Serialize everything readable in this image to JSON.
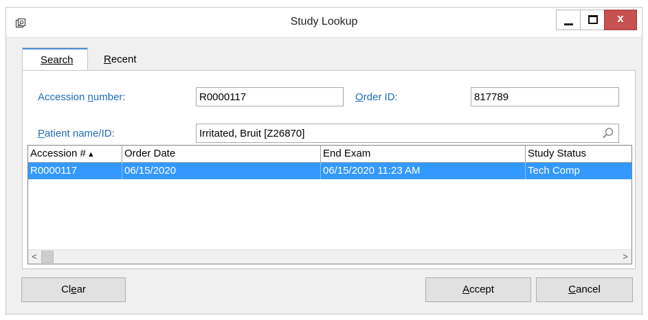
{
  "window": {
    "title": "Study Lookup",
    "close_glyph": "x"
  },
  "tabs": {
    "search": "Search",
    "recent": "Recent"
  },
  "fields": {
    "accession_label": "Accession number:",
    "accession_value": "R0000117",
    "order_id_label": "Order ID:",
    "order_id_value": "817789",
    "patient_label": "Patient name/ID:",
    "patient_value": "Irritated, Bruit [Z26870]"
  },
  "grid": {
    "columns": [
      "Accession #",
      "Order Date",
      "End Exam",
      "Study Status"
    ],
    "sort_indicator": "▲",
    "rows": [
      [
        "R0000117",
        "06/15/2020",
        "06/15/2020 11:23 AM",
        "Tech Comp"
      ]
    ],
    "selected_row_color": "#3399ff"
  },
  "buttons": {
    "clear": "Clear",
    "accept": "Accept",
    "cancel": "Cancel"
  },
  "icons": {
    "app": "restore-window-icon",
    "search": "magnifier-icon"
  },
  "colors": {
    "label_blue": "#1f6cb8",
    "close_red": "#c75050",
    "tab_accent": "#4a8fd6"
  }
}
